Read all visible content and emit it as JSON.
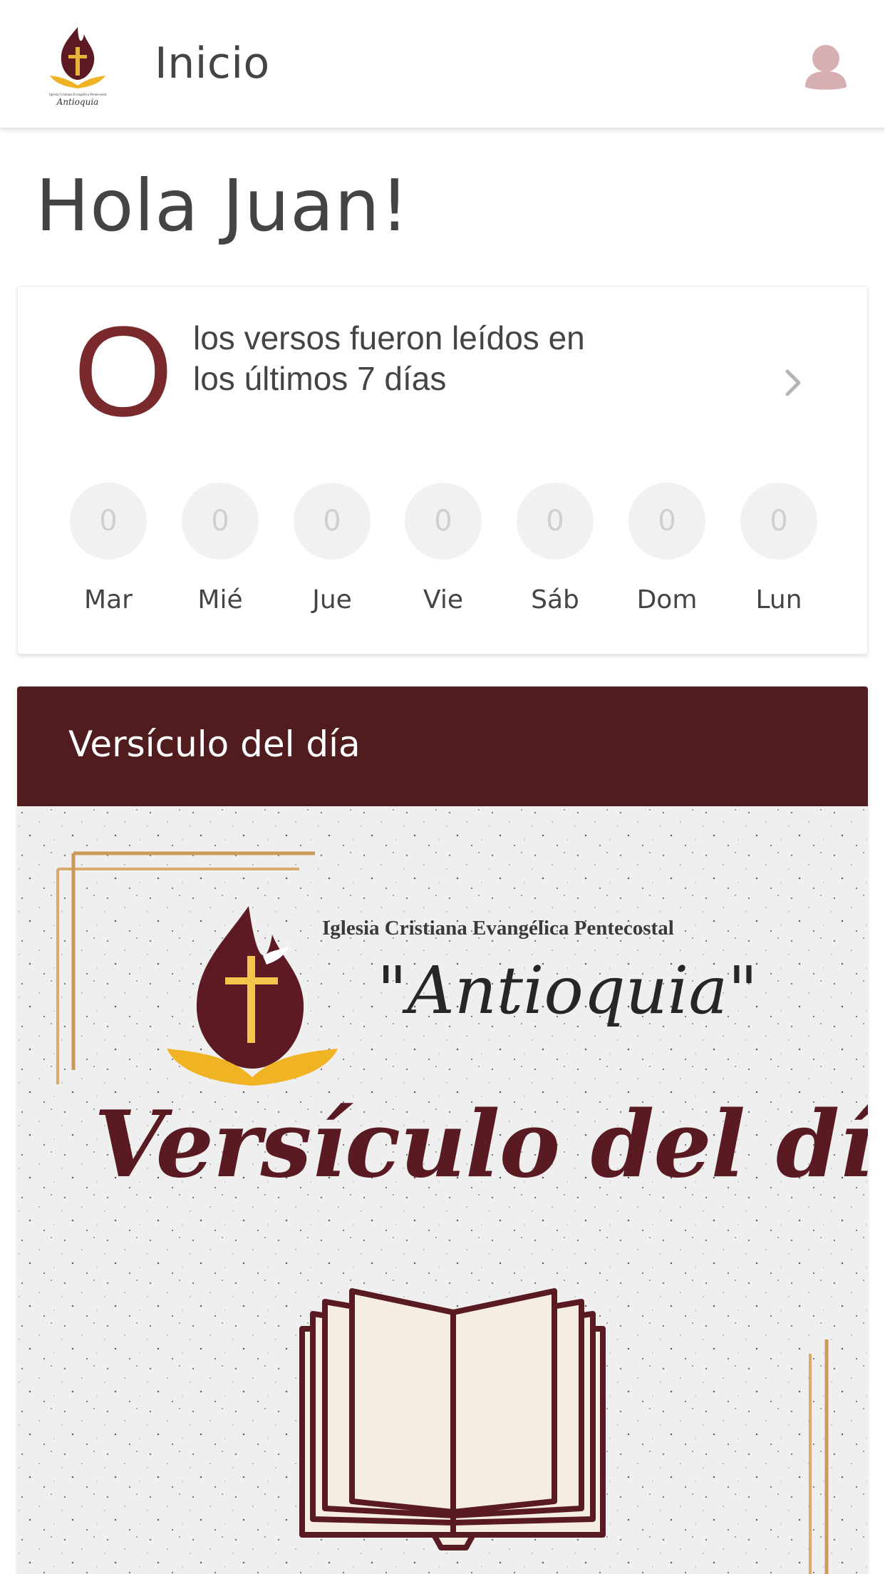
{
  "header": {
    "title": "Inicio",
    "logo_icon": "church-logo-icon",
    "avatar_icon": "user-avatar-icon"
  },
  "greeting": "Hola Juan!",
  "stats": {
    "count": "O",
    "description": "los versos fueron leídos en los últimos 7 días",
    "days": [
      {
        "label": "Mar",
        "value": "0"
      },
      {
        "label": "Mié",
        "value": "0"
      },
      {
        "label": "Jue",
        "value": "0"
      },
      {
        "label": "Vie",
        "value": "0"
      },
      {
        "label": "Sáb",
        "value": "0"
      },
      {
        "label": "Dom",
        "value": "0"
      },
      {
        "label": "Lun",
        "value": "0"
      }
    ]
  },
  "verse": {
    "header_title": "Versículo del día",
    "image": {
      "org_name": "Iglesia Cristiana Evangélica Pentecostal",
      "org_script": "\"Antioquia\"",
      "title": "Versículo del día"
    }
  },
  "colors": {
    "accent": "#7a2a2d",
    "verse_header_bg": "#501c1d",
    "day_circle_bg": "#f1f1f2",
    "avatar": "#d7aeb1"
  }
}
